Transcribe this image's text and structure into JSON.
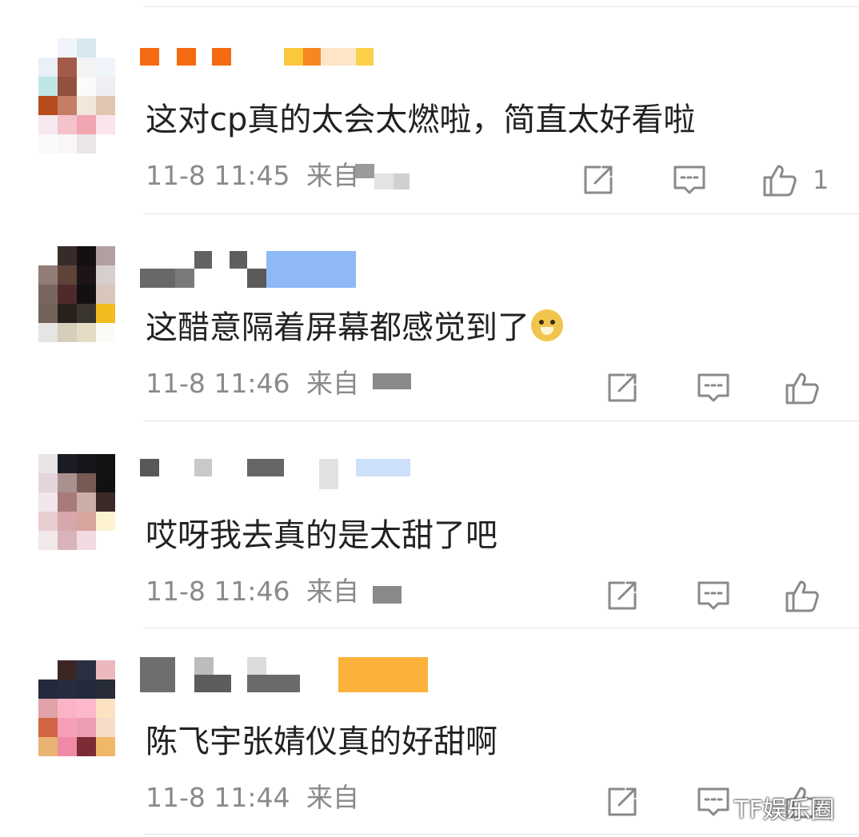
{
  "comments": [
    {
      "text": "这对cp真的太会太燃啦，简直太好看啦",
      "time": "11-8 11:45",
      "source_label": "来自",
      "like_count": "1",
      "avatar_colors": [
        "#ffffff",
        "#f0f3f8",
        "#d8e8ef",
        "#ffffff",
        "#e9f0f8",
        "#a25b48",
        "#f3f3f3",
        "#eef4fa",
        "#bfe6e6",
        "#93503f",
        "#fbfbfb",
        "#efeef2",
        "#b74c1d",
        "#c47d64",
        "#f1e7da",
        "#e1c5b0",
        "#f6e8ee",
        "#f4c2cb",
        "#f0a5b0",
        "#fbe4ea",
        "#fbf9fa",
        "#f8f6f7",
        "#ece6e9",
        "#ffffff"
      ],
      "name_colors": [
        "#f46a10",
        "#f46a10",
        "#f46a10",
        "#fbc83c",
        "#f7881f",
        "#fde6c8",
        "#fbd04a"
      ]
    },
    {
      "text": "这醋意隔着屏幕都感觉到了",
      "time": "11-8 11:46",
      "source_label": "来自",
      "like_count": "",
      "avatar_colors": [
        "#ffffff",
        "#3a2b2b",
        "#15100f",
        "#b1a0a0",
        "#917d76",
        "#5e4338",
        "#1d1515",
        "#d7cfcd",
        "#7a6660",
        "#4f2a2a",
        "#121010",
        "#d9c7be",
        "#71635a",
        "#27201d",
        "#3b352f",
        "#f2bc1f",
        "#e6e5e3",
        "#d6cebb",
        "#e4dcc4",
        "#fbfaf5"
      ],
      "name_colors": [
        "#686868",
        "#7a7a7a",
        "#626262",
        "#5e5e5e",
        "#5a5a5a",
        "#8eb8f6"
      ]
    },
    {
      "text": "哎呀我去真的是太甜了吧",
      "time": "11-8 11:46",
      "source_label": "来自",
      "like_count": "",
      "avatar_colors": [
        "#e7e3e7",
        "#1c1d24",
        "#14161b",
        "#121212",
        "#e4d4dc",
        "#a8918f",
        "#775a53",
        "#101111",
        "#f0e6ec",
        "#a77c78",
        "#ccaea9",
        "#3a2a27",
        "#e8cdd0",
        "#d8a7ac",
        "#d7a59d",
        "#fef3d1",
        "#f1e8ea",
        "#d8b4ba",
        "#f1dbe0",
        "#ffffff"
      ],
      "name_colors": [
        "#585858",
        "#c9c9c9",
        "#666666",
        "#e2e2e2",
        "#cde0fa"
      ]
    },
    {
      "text": "陈飞宇张婧仪真的好甜啊",
      "time": "11-8 11:44",
      "source_label": "来自",
      "like_count": "",
      "avatar_colors": [
        "#ffffff",
        "#3b2624",
        "#2a3042",
        "#ebb8bd",
        "#242a3b",
        "#262c3f",
        "#232a3c",
        "#282c39",
        "#e0a1a9",
        "#fbb4c6",
        "#ffb8cb",
        "#fde2c1",
        "#d06543",
        "#f79eb9",
        "#ec9db4",
        "#f5ddca",
        "#e9b373",
        "#f08aa4",
        "#7d2a34",
        "#f1b768"
      ],
      "name_colors": [
        "#6e6e6e",
        "#bcbcbc",
        "#5c5c5c",
        "#dcdcdc",
        "#6a6a6a",
        "#fbb23a"
      ]
    }
  ],
  "watermark": "TF娱乐圈",
  "colors": {
    "text": "#222222",
    "meta": "#8a8a8a",
    "icon": "#8a8a8a",
    "divider": "#e4e4e4"
  },
  "icons": [
    "repost-icon",
    "comment-icon",
    "thumbs-up-icon",
    "doge-emoji-icon"
  ]
}
